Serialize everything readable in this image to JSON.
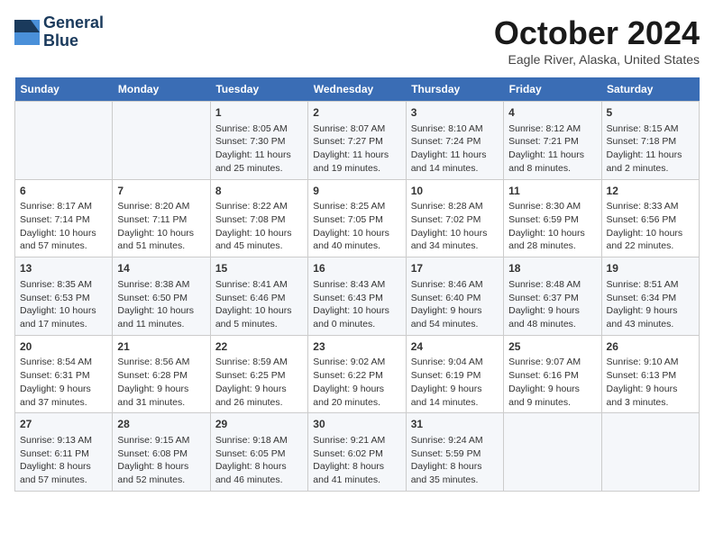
{
  "header": {
    "logo_line1": "General",
    "logo_line2": "Blue",
    "title": "October 2024",
    "subtitle": "Eagle River, Alaska, United States"
  },
  "days_of_week": [
    "Sunday",
    "Monday",
    "Tuesday",
    "Wednesday",
    "Thursday",
    "Friday",
    "Saturday"
  ],
  "weeks": [
    [
      {
        "day": "",
        "content": ""
      },
      {
        "day": "",
        "content": ""
      },
      {
        "day": "1",
        "content": "Sunrise: 8:05 AM\nSunset: 7:30 PM\nDaylight: 11 hours\nand 25 minutes."
      },
      {
        "day": "2",
        "content": "Sunrise: 8:07 AM\nSunset: 7:27 PM\nDaylight: 11 hours\nand 19 minutes."
      },
      {
        "day": "3",
        "content": "Sunrise: 8:10 AM\nSunset: 7:24 PM\nDaylight: 11 hours\nand 14 minutes."
      },
      {
        "day": "4",
        "content": "Sunrise: 8:12 AM\nSunset: 7:21 PM\nDaylight: 11 hours\nand 8 minutes."
      },
      {
        "day": "5",
        "content": "Sunrise: 8:15 AM\nSunset: 7:18 PM\nDaylight: 11 hours\nand 2 minutes."
      }
    ],
    [
      {
        "day": "6",
        "content": "Sunrise: 8:17 AM\nSunset: 7:14 PM\nDaylight: 10 hours\nand 57 minutes."
      },
      {
        "day": "7",
        "content": "Sunrise: 8:20 AM\nSunset: 7:11 PM\nDaylight: 10 hours\nand 51 minutes."
      },
      {
        "day": "8",
        "content": "Sunrise: 8:22 AM\nSunset: 7:08 PM\nDaylight: 10 hours\nand 45 minutes."
      },
      {
        "day": "9",
        "content": "Sunrise: 8:25 AM\nSunset: 7:05 PM\nDaylight: 10 hours\nand 40 minutes."
      },
      {
        "day": "10",
        "content": "Sunrise: 8:28 AM\nSunset: 7:02 PM\nDaylight: 10 hours\nand 34 minutes."
      },
      {
        "day": "11",
        "content": "Sunrise: 8:30 AM\nSunset: 6:59 PM\nDaylight: 10 hours\nand 28 minutes."
      },
      {
        "day": "12",
        "content": "Sunrise: 8:33 AM\nSunset: 6:56 PM\nDaylight: 10 hours\nand 22 minutes."
      }
    ],
    [
      {
        "day": "13",
        "content": "Sunrise: 8:35 AM\nSunset: 6:53 PM\nDaylight: 10 hours\nand 17 minutes."
      },
      {
        "day": "14",
        "content": "Sunrise: 8:38 AM\nSunset: 6:50 PM\nDaylight: 10 hours\nand 11 minutes."
      },
      {
        "day": "15",
        "content": "Sunrise: 8:41 AM\nSunset: 6:46 PM\nDaylight: 10 hours\nand 5 minutes."
      },
      {
        "day": "16",
        "content": "Sunrise: 8:43 AM\nSunset: 6:43 PM\nDaylight: 10 hours\nand 0 minutes."
      },
      {
        "day": "17",
        "content": "Sunrise: 8:46 AM\nSunset: 6:40 PM\nDaylight: 9 hours\nand 54 minutes."
      },
      {
        "day": "18",
        "content": "Sunrise: 8:48 AM\nSunset: 6:37 PM\nDaylight: 9 hours\nand 48 minutes."
      },
      {
        "day": "19",
        "content": "Sunrise: 8:51 AM\nSunset: 6:34 PM\nDaylight: 9 hours\nand 43 minutes."
      }
    ],
    [
      {
        "day": "20",
        "content": "Sunrise: 8:54 AM\nSunset: 6:31 PM\nDaylight: 9 hours\nand 37 minutes."
      },
      {
        "day": "21",
        "content": "Sunrise: 8:56 AM\nSunset: 6:28 PM\nDaylight: 9 hours\nand 31 minutes."
      },
      {
        "day": "22",
        "content": "Sunrise: 8:59 AM\nSunset: 6:25 PM\nDaylight: 9 hours\nand 26 minutes."
      },
      {
        "day": "23",
        "content": "Sunrise: 9:02 AM\nSunset: 6:22 PM\nDaylight: 9 hours\nand 20 minutes."
      },
      {
        "day": "24",
        "content": "Sunrise: 9:04 AM\nSunset: 6:19 PM\nDaylight: 9 hours\nand 14 minutes."
      },
      {
        "day": "25",
        "content": "Sunrise: 9:07 AM\nSunset: 6:16 PM\nDaylight: 9 hours\nand 9 minutes."
      },
      {
        "day": "26",
        "content": "Sunrise: 9:10 AM\nSunset: 6:13 PM\nDaylight: 9 hours\nand 3 minutes."
      }
    ],
    [
      {
        "day": "27",
        "content": "Sunrise: 9:13 AM\nSunset: 6:11 PM\nDaylight: 8 hours\nand 57 minutes."
      },
      {
        "day": "28",
        "content": "Sunrise: 9:15 AM\nSunset: 6:08 PM\nDaylight: 8 hours\nand 52 minutes."
      },
      {
        "day": "29",
        "content": "Sunrise: 9:18 AM\nSunset: 6:05 PM\nDaylight: 8 hours\nand 46 minutes."
      },
      {
        "day": "30",
        "content": "Sunrise: 9:21 AM\nSunset: 6:02 PM\nDaylight: 8 hours\nand 41 minutes."
      },
      {
        "day": "31",
        "content": "Sunrise: 9:24 AM\nSunset: 5:59 PM\nDaylight: 8 hours\nand 35 minutes."
      },
      {
        "day": "",
        "content": ""
      },
      {
        "day": "",
        "content": ""
      }
    ]
  ]
}
